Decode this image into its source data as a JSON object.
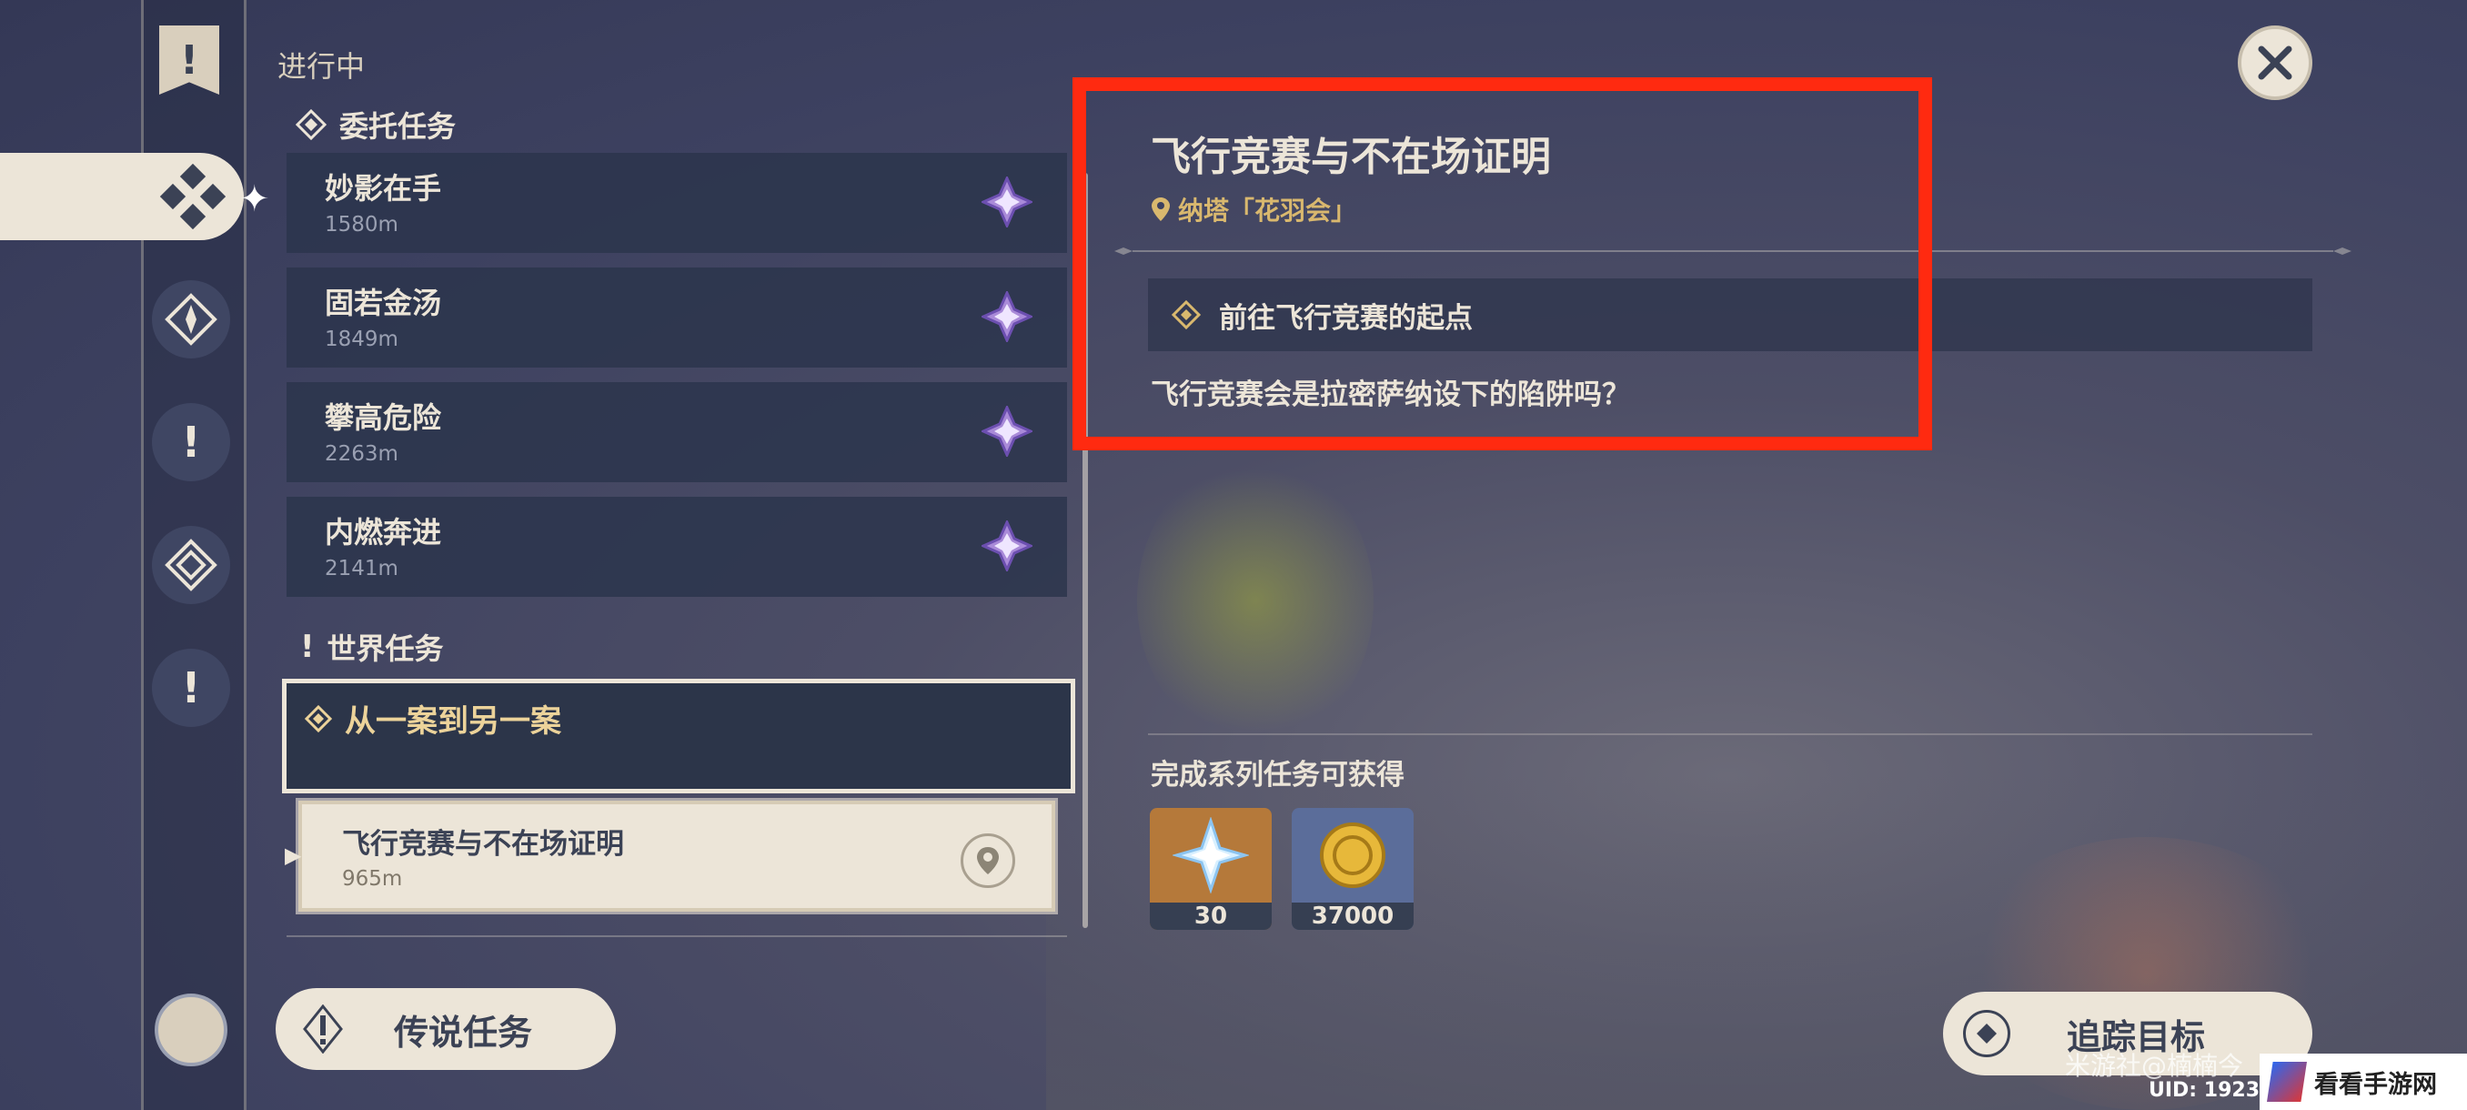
{
  "left": {
    "section_title": "进行中",
    "commission_category": "委托任务",
    "commissions": [
      {
        "name": "妙影在手",
        "distance": "1580m"
      },
      {
        "name": "固若金汤",
        "distance": "1849m"
      },
      {
        "name": "攀高危险",
        "distance": "2263m"
      },
      {
        "name": "内燃奔进",
        "distance": "2141m"
      }
    ],
    "world_category": "世界任务",
    "world_quest": {
      "name": "从一案到另一案"
    },
    "sub_quest": {
      "name": "飞行竞赛与不在场证明",
      "distance": "965m"
    },
    "legend_button": "传说任务"
  },
  "detail": {
    "title": "飞行竞赛与不在场证明",
    "location": "纳塔「花羽会」",
    "objective": "前往飞行竞赛的起点",
    "description": "飞行竞赛会是拉密萨纳设下的陷阱吗？",
    "reward_title": "完成系列任务可获得",
    "rewards": [
      {
        "icon": "primogem-icon",
        "count": "30"
      },
      {
        "icon": "mora-icon",
        "count": "37000"
      }
    ],
    "track_button": "追踪目标"
  },
  "overlay": {
    "watermark": "米游社@楠楠今",
    "uid": "UID: 19234",
    "site": "看看手游网"
  },
  "colors": {
    "highlight": "#ff2a10",
    "panel": "#2c3549",
    "cream": "#ece5d8",
    "gold": "#d9b86e"
  }
}
